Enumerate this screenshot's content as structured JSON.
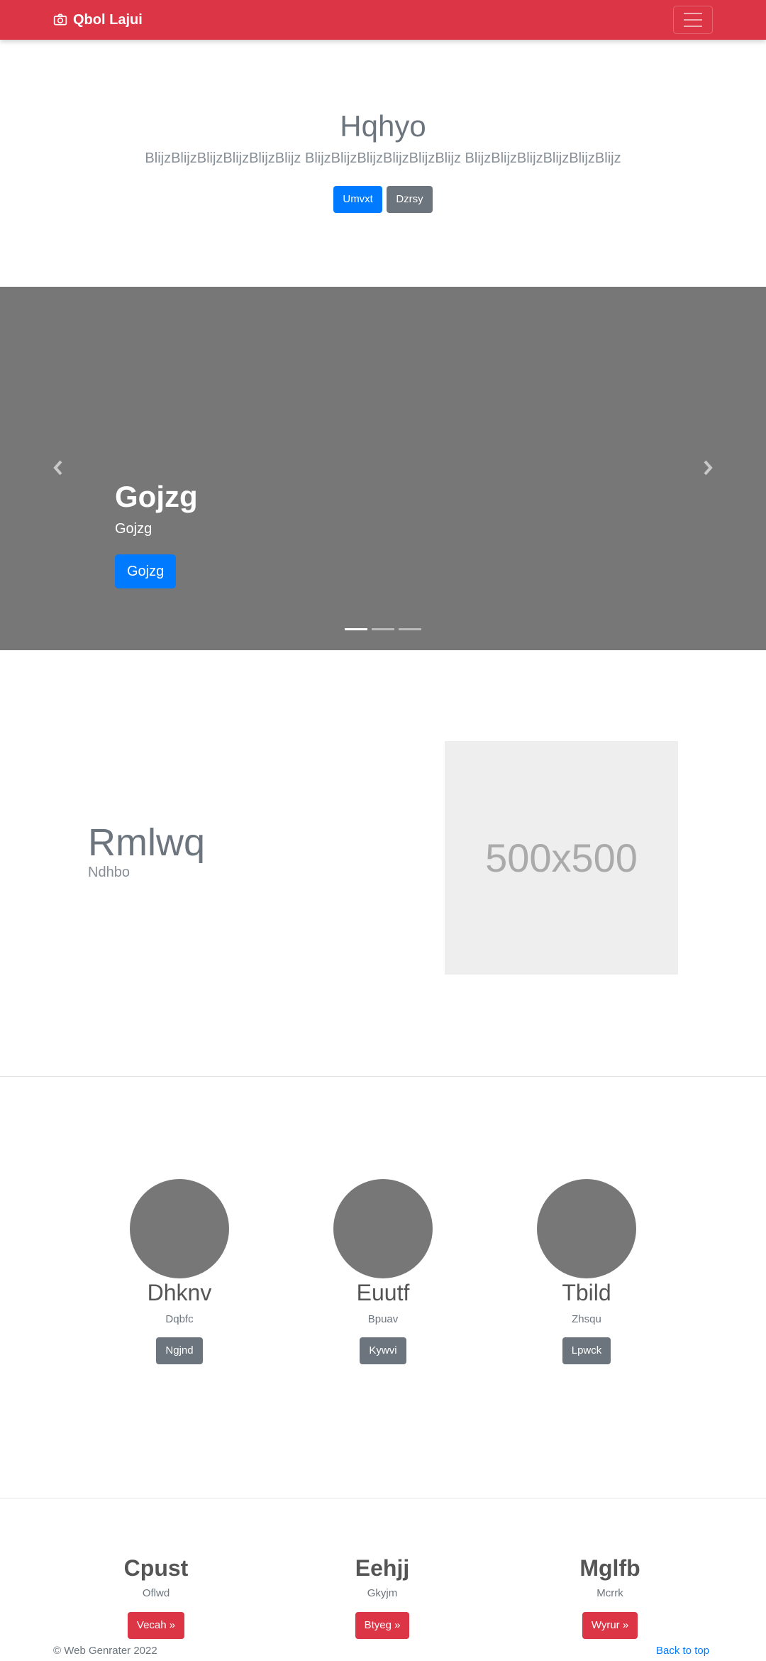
{
  "navbar": {
    "brand": "Qbol Lajui",
    "brand_icon": "camera-icon",
    "toggler_icon": "hamburger-menu-icon",
    "color": "#dc3545"
  },
  "hero": {
    "title": "Hqhyo",
    "subtitle": "BlijzBlijzBlijzBlijzBlijzBlijz BlijzBlijzBlijzBlijzBlijzBlijz BlijzBlijzBlijzBlijzBlijzBlijz",
    "primary_button": "Umvxt",
    "secondary_button": "Dzrsy"
  },
  "carousel": {
    "title": "Gojzg",
    "text": "Gojzg",
    "button": "Gojzg",
    "prev_icon": "chevron-left-icon",
    "next_icon": "chevron-right-icon",
    "slide_count": 3,
    "active_slide": 1
  },
  "feature": {
    "title": "Rmlwq",
    "text": "Ndhbo",
    "image_label": "500x500"
  },
  "people": [
    {
      "name": "Dhknv",
      "text": "Dqbfc",
      "button": "Ngjnd"
    },
    {
      "name": "Euutf",
      "text": "Bpuav",
      "button": "Kywvi"
    },
    {
      "name": "Tbild",
      "text": "Zhsqu",
      "button": "Lpwck"
    }
  ],
  "offers": [
    {
      "title": "Cpust",
      "text": "Oflwd",
      "button": "Vecah »"
    },
    {
      "title": "Eehjj",
      "text": "Gkyjm",
      "button": "Btyeg »"
    },
    {
      "title": "Mglfb",
      "text": "Mcrrk",
      "button": "Wyrur »"
    }
  ],
  "footer": {
    "copyright": "© Web Genrater 2022",
    "back_to_top": "Back to top"
  }
}
